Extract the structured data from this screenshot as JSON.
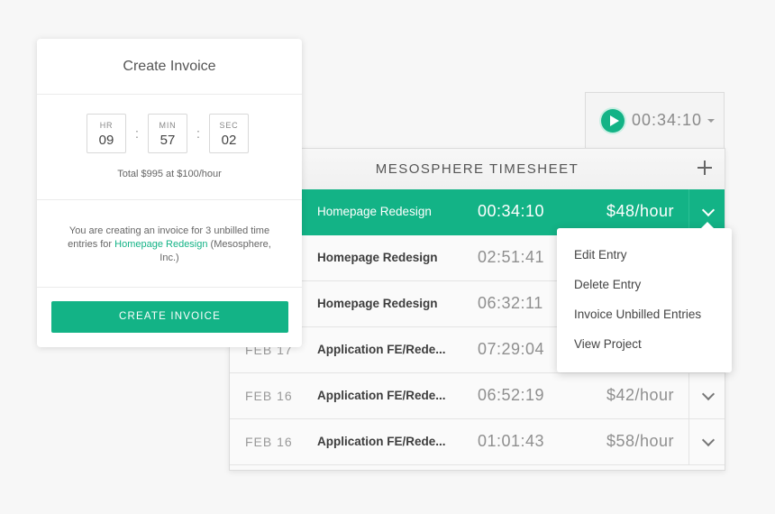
{
  "timer": {
    "time": "00:34:10"
  },
  "timesheet": {
    "title": "MESOSPHERE TIMESHEET",
    "rows": [
      {
        "date": "",
        "project": "Homepage Redesign",
        "time": "00:34:10",
        "rate": "$48/hour",
        "active": true
      },
      {
        "date": "",
        "project": "Homepage Redesign",
        "time": "02:51:41",
        "rate": "",
        "active": false
      },
      {
        "date": "",
        "project": "Homepage Redesign",
        "time": "06:32:11",
        "rate": "",
        "active": false
      },
      {
        "date": "FEB 17",
        "project": "Application FE/Rede...",
        "time": "07:29:04",
        "rate": "",
        "active": false
      },
      {
        "date": "FEB 16",
        "project": "Application FE/Rede...",
        "time": "06:52:19",
        "rate": "$42/hour",
        "active": false
      },
      {
        "date": "FEB 16",
        "project": "Application FE/Rede...",
        "time": "01:01:43",
        "rate": "$58/hour",
        "active": false
      }
    ]
  },
  "menu": {
    "items": [
      "Edit Entry",
      "Delete Entry",
      "Invoice Unbilled Entries",
      "View Project"
    ]
  },
  "invoice": {
    "title": "Create Invoice",
    "hours_label": "HR",
    "hours": "09",
    "minutes_label": "MIN",
    "minutes": "57",
    "seconds_label": "SEC",
    "seconds": "02",
    "total": "Total $995 at $100/hour",
    "desc_before": "You are creating an invoice for 3 unbilled time entries for ",
    "desc_link": "Homepage Redesign",
    "desc_after": " (Mesosphere, Inc.)",
    "button": "CREATE INVOICE"
  },
  "colors": {
    "accent": "#13b386"
  },
  "icons": {
    "play": "play-icon",
    "add": "plus-icon",
    "expand": "chevron-down-icon",
    "dropdown": "caret-down-icon"
  }
}
